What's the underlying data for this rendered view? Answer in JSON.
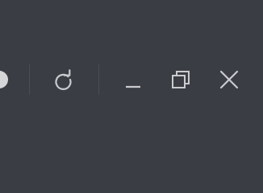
{
  "window_controls": {
    "partial_control": {
      "icon": "circle-icon"
    },
    "reload": {
      "icon": "reload-icon",
      "color": "#c9cbce"
    },
    "minimize": {
      "icon": "minimize-icon",
      "color": "#c9cbce"
    },
    "restore": {
      "icon": "restore-icon",
      "color": "#c9cbce"
    },
    "close": {
      "icon": "close-icon",
      "color": "#c9cbce"
    }
  },
  "colors": {
    "background": "#3a3d43",
    "icon": "#c9cbce",
    "divider": "#4a4d53"
  }
}
